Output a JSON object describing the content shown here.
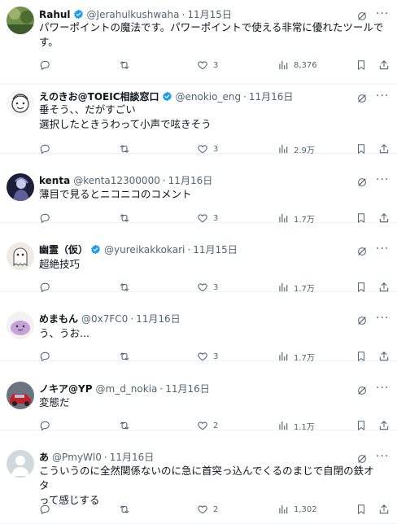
{
  "tweets": [
    {
      "name": "Rahul",
      "verified": true,
      "handle": "@Jerahulkushwaha",
      "separator": "·",
      "time": "11月15日",
      "lines": [
        "パワーポイントの魔法です。パワーポイントで使える非常に優れたツールで",
        "す。"
      ],
      "reply_count": "",
      "retweet_count": "",
      "like_count": "3",
      "view_count": "8,376",
      "avatar_icon": "avatar-green-photo"
    },
    {
      "name": "えのきお@TOEIC相談窓口",
      "verified": true,
      "handle": "@enokio_eng",
      "separator": "·",
      "time": "11月16日",
      "lines": [
        "垂そう、、だがすごい",
        "選択したときうわって小声で呟きそう"
      ],
      "reply_count": "",
      "retweet_count": "",
      "like_count": "3",
      "view_count": "2.9万",
      "avatar_icon": "avatar-sketch-face"
    },
    {
      "name": "kenta",
      "verified": false,
      "handle": "@kenta12300000",
      "separator": "·",
      "time": "11月16日",
      "lines": [
        "薄目で見るとニコニコのコメント"
      ],
      "reply_count": "",
      "retweet_count": "",
      "like_count": "3",
      "view_count": "1.7万",
      "avatar_icon": "avatar-dark-figure"
    },
    {
      "name": "幽霊（仮）",
      "verified": true,
      "handle": "@yureikakkokari",
      "separator": "·",
      "time": "11月15日",
      "lines": [
        "超絶技巧"
      ],
      "reply_count": "",
      "retweet_count": "",
      "like_count": "3",
      "view_count": "1.7万",
      "avatar_icon": "avatar-ghost"
    },
    {
      "name": "めまもん",
      "verified": false,
      "handle": "@0x7FC0",
      "separator": "·",
      "time": "11月16日",
      "lines": [
        "う、うお..."
      ],
      "reply_count": "",
      "retweet_count": "",
      "like_count": "3",
      "view_count": "1.7万",
      "avatar_icon": "avatar-purple-blob"
    },
    {
      "name": "ノキア@YP",
      "verified": false,
      "handle": "@m_d_nokia",
      "separator": "·",
      "time": "11月16日",
      "lines": [
        "変態だ"
      ],
      "reply_count": "",
      "retweet_count": "",
      "like_count": "2",
      "view_count": "1.1万",
      "avatar_icon": "avatar-red-car"
    },
    {
      "name": "あ",
      "verified": false,
      "handle": "@PmyWl0",
      "separator": "·",
      "time": "11月16日",
      "lines": [
        "こういうのに全然関係ないのに急に首突っ込んでくるのまじで自閉の鉄オタ",
        "って感じする"
      ],
      "reply_count": "",
      "retweet_count": "",
      "like_count": "2",
      "view_count": "1,302",
      "avatar_icon": "avatar-default-person"
    }
  ],
  "icons": {
    "reply": "reply-icon",
    "retweet": "retweet-icon",
    "like": "like-icon",
    "views": "views-icon",
    "bookmark": "bookmark-icon",
    "share": "share-icon",
    "grok": "grok-icon",
    "more": "more-icon",
    "verified": "verified-badge-icon"
  },
  "colors": {
    "text": "#0f1419",
    "muted": "#536471",
    "verified": "#1d9bf0",
    "divider": "#eff3f4"
  }
}
